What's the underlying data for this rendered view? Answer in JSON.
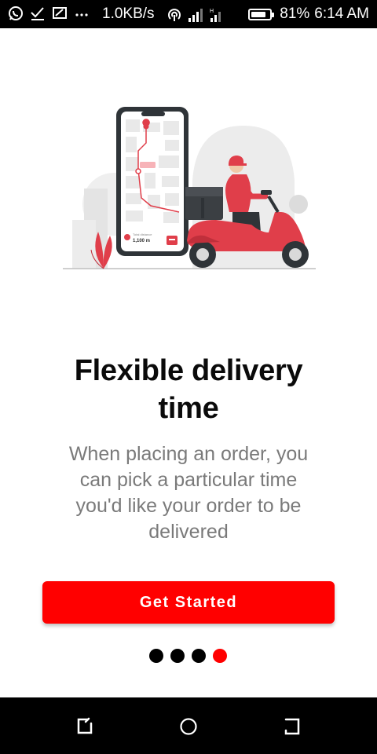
{
  "status_bar": {
    "net_speed": "1.0KB/s",
    "battery_percent": "81%",
    "battery_level": 0.81,
    "time": "6:14 AM"
  },
  "illustration": {
    "distance_label": "Total distance",
    "distance_value": "1,100 m"
  },
  "onboarding": {
    "title_line1": "Flexible delivery",
    "title_line2": "time",
    "desc_line1": "When placing an order, you",
    "desc_line2": "can pick a particular time",
    "desc_line3": "you'd like your order to be",
    "desc_line4": "delivered",
    "cta_label": "Get Started",
    "page_count": 4,
    "active_page": 4
  },
  "colors": {
    "accent": "#ff0000",
    "text_primary": "#0a0a0a",
    "text_secondary": "#7a7a7a"
  }
}
